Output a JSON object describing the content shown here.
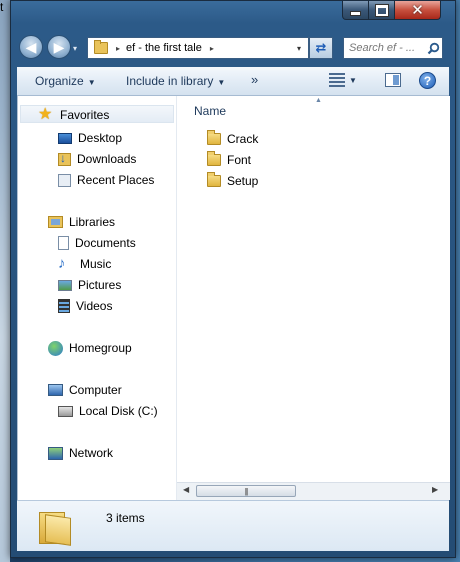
{
  "desktop": {
    "glyph": "t"
  },
  "window": {
    "caption": {
      "minimize": "minimize-icon",
      "maximize": "maximize-icon",
      "close": "close-icon"
    },
    "address": {
      "path": "ef - the first tale",
      "separator": "▸",
      "dropdown": "▾"
    },
    "search": {
      "placeholder": "Search ef - ..."
    },
    "toolbar": {
      "organize": "Organize",
      "include": "Include in library",
      "more": "»"
    },
    "nav_pane": {
      "favorites": {
        "label": "Favorites",
        "items": [
          {
            "label": "Desktop",
            "icon": "desktop-icon"
          },
          {
            "label": "Downloads",
            "icon": "downloads-icon"
          },
          {
            "label": "Recent Places",
            "icon": "recent-places-icon"
          }
        ]
      },
      "libraries": {
        "label": "Libraries",
        "items": [
          {
            "label": "Documents",
            "icon": "documents-icon"
          },
          {
            "label": "Music",
            "icon": "music-icon"
          },
          {
            "label": "Pictures",
            "icon": "pictures-icon"
          },
          {
            "label": "Videos",
            "icon": "videos-icon"
          }
        ]
      },
      "homegroup": {
        "label": "Homegroup"
      },
      "computer": {
        "label": "Computer",
        "items": [
          {
            "label": "Local Disk (C:)",
            "icon": "local-disk-icon"
          }
        ]
      },
      "network": {
        "label": "Network"
      }
    },
    "files": {
      "column_header": "Name",
      "items": [
        "Crack",
        "Font",
        "Setup"
      ]
    },
    "details": {
      "count": "3 items"
    },
    "colors": {
      "frame": "#2c5a88",
      "toolbar": "#e3ecf6",
      "folder": "#e9c35a",
      "close_button": "#c7503e"
    }
  }
}
